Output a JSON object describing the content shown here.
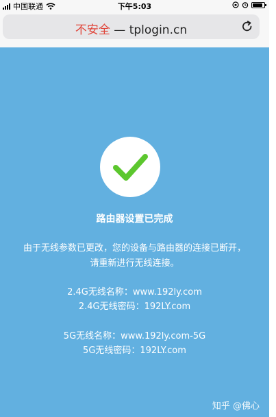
{
  "status_bar": {
    "carrier": "中国联通",
    "time": "下午5:03"
  },
  "address_bar": {
    "security_label": "不安全",
    "separator": " — ",
    "url": "tplogin.cn"
  },
  "main": {
    "title": "路由器设置已完成",
    "description": "由于无线参数已更改，您的设备与路由器的连接已断开，请重新进行无线连接。",
    "wifi_24g": {
      "name_line": "2.4G无线名称：www.192ly.com",
      "password_line": "2.4G无线密码：192LY.com"
    },
    "wifi_5g": {
      "name_line": "5G无线名称：www.192ly.com-5G",
      "password_line": "5G无线密码：192LY.com"
    }
  },
  "watermark": "知乎 @佛心",
  "colors": {
    "background": "#62b0e0",
    "check": "#5cc72e",
    "insecure": "#e0453a"
  },
  "icons": [
    "signal-icon",
    "wifi-icon",
    "orientation-lock-icon",
    "alarm-icon",
    "battery-icon",
    "reload-icon",
    "checkmark-icon"
  ]
}
